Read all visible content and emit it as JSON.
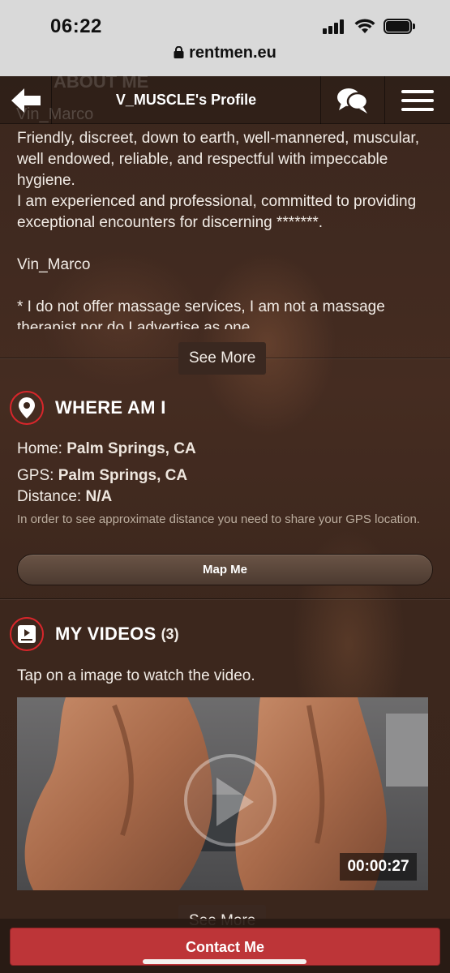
{
  "status_bar": {
    "time": "06:22",
    "url": "rentmen.eu"
  },
  "nav": {
    "title": "V_MUSCLE's Profile",
    "ghost_heading": "ABOUT ME",
    "ghost_name": "Vin_Marco"
  },
  "about": {
    "lines": [
      "Friendly, discreet, down to earth, well-mannered, muscular, well endowed, reliable, and respectful with impeccable hygiene.",
      "I am experienced and professional, committed to providing exceptional encounters for discerning *******.",
      "Vin_Marco",
      "* I do not offer massage services, I am not a massage therapist nor do I advertise as one."
    ],
    "see_more_label": "See More"
  },
  "where_am_i": {
    "title": "WHERE AM I",
    "home_label": "Home:",
    "home_value": "Palm Springs, CA",
    "gps_label": "GPS:",
    "gps_value": "Palm Springs, CA",
    "distance_label": "Distance:",
    "distance_value": "N/A",
    "note": "In order to see approximate distance you need to share your GPS location.",
    "map_button": "Map Me"
  },
  "videos": {
    "title": "MY VIDEOS",
    "count": "(3)",
    "tap_note": "Tap on a image to watch the video.",
    "duration": "00:00:27",
    "see_more_label": "See More"
  },
  "contact_button": "Contact Me",
  "colors": {
    "accent_red": "#d8262b",
    "contact_red": "#bd3538",
    "background_brown": "#3a251b"
  }
}
